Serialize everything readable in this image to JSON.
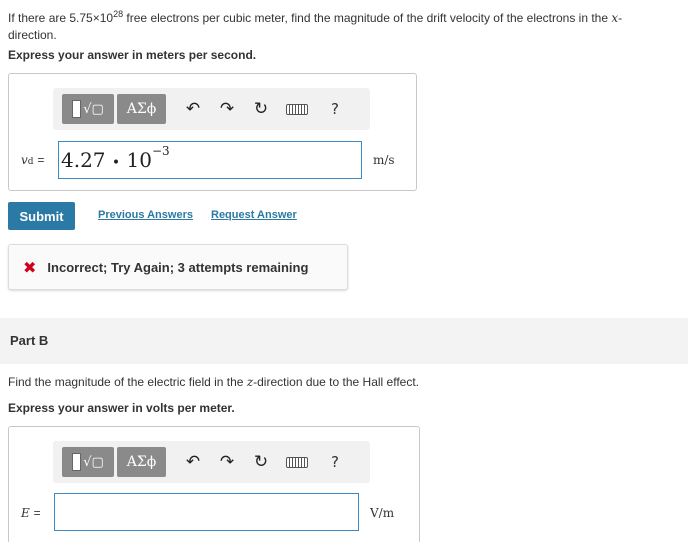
{
  "part_a": {
    "question_line1_pre": "If there are 5.75×10",
    "question_exp": "28",
    "question_line1_post": " free electrons per cubic meter, find the magnitude of the drift velocity of the electrons in the ",
    "question_var": "x",
    "question_line1_end": "-",
    "question_line2": "direction.",
    "instruction": "Express your answer in meters per second.",
    "var_label": "vd",
    "var_main": "v",
    "var_sub": "d",
    "equals": "=",
    "answer_mantissa": "4.27",
    "answer_dot": "•",
    "answer_base": "10",
    "answer_exp": "−3",
    "unit": "m/s"
  },
  "toolbar": {
    "templates_icon": "fraction-sqrt-icon",
    "greek_label": "ΑΣϕ",
    "undo_icon": "undo-icon",
    "redo_icon": "redo-icon",
    "reset_icon": "reset-icon",
    "keyboard_icon": "keyboard-icon",
    "help_label": "?"
  },
  "actions": {
    "submit": "Submit",
    "previous_answers": "Previous Answers",
    "request_answer": "Request Answer"
  },
  "feedback": {
    "icon": "x-icon",
    "text": "Incorrect; Try Again; 3 attempts remaining"
  },
  "part_b": {
    "title": "Part B",
    "question_pre": "Find the magnitude of the electric field in the ",
    "question_var": "z",
    "question_post": "-direction due to the Hall effect.",
    "instruction": "Express your answer in volts per meter.",
    "var_label": "E",
    "equals": "=",
    "answer_value": "",
    "unit": "V/m"
  },
  "colors": {
    "accent": "#2a7aa5",
    "error": "#d0021b",
    "toolbar_button": "#8a8a8a",
    "input_border": "#3a8bc4"
  }
}
